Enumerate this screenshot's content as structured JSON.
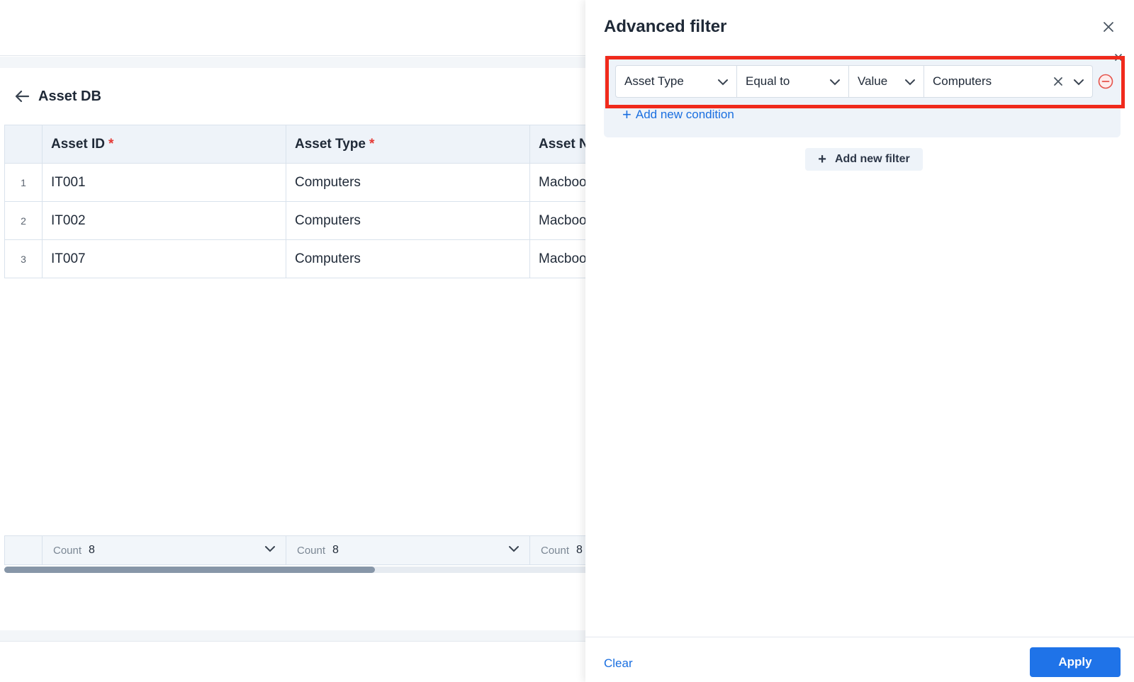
{
  "page": {
    "title": "Asset DB"
  },
  "table": {
    "columns": [
      {
        "label": "Asset ID",
        "required": "*"
      },
      {
        "label": "Asset Type",
        "required": "*"
      },
      {
        "label": "Asset N"
      }
    ],
    "rows": [
      {
        "num": "1",
        "cells": [
          "IT001",
          "Computers",
          "Macboo"
        ]
      },
      {
        "num": "2",
        "cells": [
          "IT002",
          "Computers",
          "Macboo"
        ]
      },
      {
        "num": "3",
        "cells": [
          "IT007",
          "Computers",
          "Macboo"
        ]
      }
    ],
    "footer": [
      {
        "label": "Count",
        "value": "8"
      },
      {
        "label": "Count",
        "value": "8"
      },
      {
        "label": "Count",
        "value": "8"
      }
    ],
    "scroll_fraction": 0.63
  },
  "drawer": {
    "title": "Advanced filter",
    "condition": {
      "field": "Asset Type",
      "operator": "Equal to",
      "value_type": "Value",
      "value": "Computers"
    },
    "add_condition_label": "Add new condition",
    "add_filter_label": "Add new filter",
    "clear_label": "Clear",
    "apply_label": "Apply"
  },
  "colors": {
    "primary": "#1f73e8",
    "link": "#1a6fe0",
    "highlight": "#f02a1c",
    "required": "#e53935",
    "remove": "#e5534b"
  }
}
